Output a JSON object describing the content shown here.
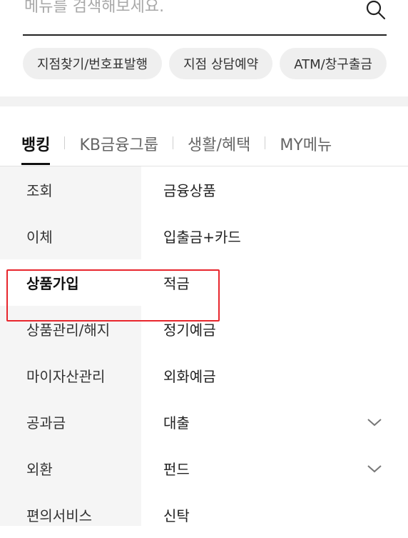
{
  "search": {
    "placeholder": "메뉴를 검색해보세요."
  },
  "quick_links": [
    "지점찾기/번호표발행",
    "지점 상담예약",
    "ATM/창구출금"
  ],
  "tabs": [
    {
      "label": "뱅킹",
      "active": true
    },
    {
      "label": "KB금융그룹",
      "active": false
    },
    {
      "label": "생활/혜택",
      "active": false
    },
    {
      "label": "MY메뉴",
      "active": false
    }
  ],
  "sidebar": {
    "items": [
      {
        "label": "조회"
      },
      {
        "label": "이체"
      },
      {
        "label": "상품가입",
        "active": true
      },
      {
        "label": "상품관리/해지"
      },
      {
        "label": "마이자산관리"
      },
      {
        "label": "공과금"
      },
      {
        "label": "외환"
      },
      {
        "label": "편의서비스"
      }
    ]
  },
  "submenu": {
    "items": [
      {
        "label": "금융상품"
      },
      {
        "label": "입출금+카드"
      },
      {
        "label": "적금"
      },
      {
        "label": "정기예금"
      },
      {
        "label": "외화예금"
      },
      {
        "label": "대출",
        "expandable": true
      },
      {
        "label": "펀드",
        "expandable": true
      },
      {
        "label": "신탁"
      }
    ]
  },
  "colors": {
    "highlight": "#e8262d",
    "sidebar_bg": "#f5f5f5",
    "chip_bg": "#efefef"
  }
}
